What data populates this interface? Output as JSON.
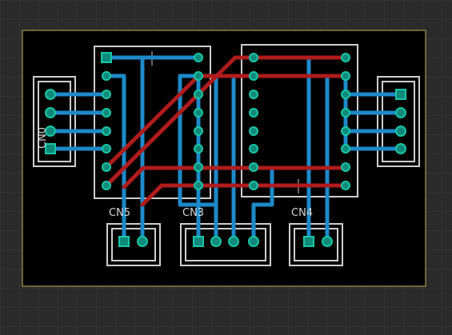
{
  "labels": {
    "cn5": "CN5",
    "cn3": "CN3",
    "cn4": "CN4",
    "cn0": "CN0"
  },
  "colors": {
    "background": "#2a2a2a",
    "grid": "#3a3a3a",
    "board_outline": "#c8b45a",
    "silkscreen": "#cfcfcf",
    "bottom_trace": "#1d8ac9",
    "top_trace": "#b01c1c",
    "pad": "#16c7a7"
  }
}
